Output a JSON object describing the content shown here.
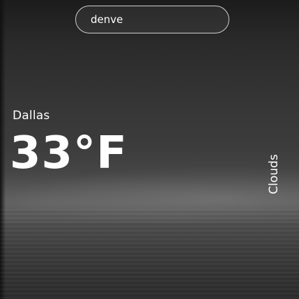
{
  "search": {
    "value": "denve",
    "placeholder": ""
  },
  "weather": {
    "city": "Dallas",
    "temperature": "33°F",
    "condition": "Clouds"
  }
}
